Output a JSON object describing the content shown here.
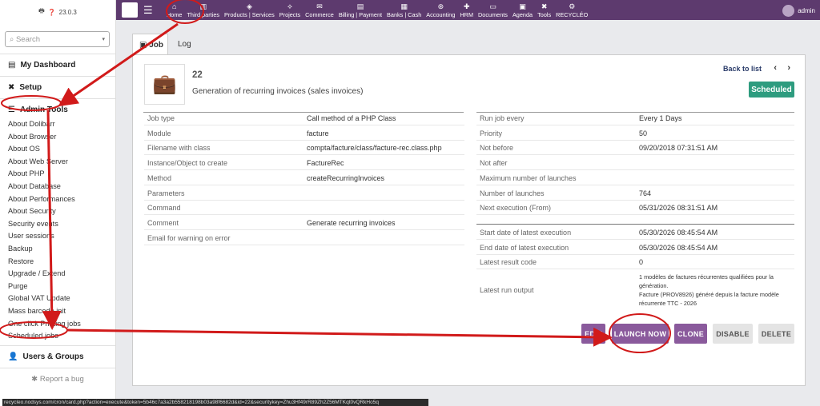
{
  "app": {
    "version": "23.0.3",
    "user": "admin"
  },
  "sidebar": {
    "search_placeholder": "Search",
    "dashboard": "My Dashboard",
    "setup": "Setup",
    "admin_tools": "Admin Tools",
    "items": [
      "About Dolibarr",
      "About Browser",
      "About OS",
      "About Web Server",
      "About PHP",
      "About Database",
      "About Performances",
      "About Security",
      "Security events",
      "User sessions",
      "Backup",
      "Restore",
      "Upgrade / Extend",
      "Purge",
      "Global VAT Update",
      "Mass barcode init",
      "One click Printing jobs",
      "Scheduled jobs"
    ],
    "users_groups": "Users & Groups",
    "report_bug": "Report a bug"
  },
  "topnav": [
    "Home",
    "Third parties",
    "Products | Services",
    "Projects",
    "Commerce",
    "Billing | Payment",
    "Banks | Cash",
    "Accounting",
    "HRM",
    "Documents",
    "Agenda",
    "Tools",
    "RECYCLÉO"
  ],
  "tabs": [
    "Job",
    "Log"
  ],
  "job": {
    "id": "22",
    "title": "Generation of recurring invoices (sales invoices)",
    "back": "Back to list",
    "status": "Scheduled",
    "left": [
      {
        "label": "Job type",
        "value": "Call method of a PHP Class"
      },
      {
        "label": "Module",
        "value": "facture"
      },
      {
        "label": "Filename with class",
        "value": "compta/facture/class/facture-rec.class.php"
      },
      {
        "label": "Instance/Object to create",
        "value": "FactureRec"
      },
      {
        "label": "Method",
        "value": "createRecurringInvoices"
      },
      {
        "label": "Parameters",
        "value": ""
      },
      {
        "label": "Command",
        "value": ""
      },
      {
        "label": "Comment",
        "value": "Generate recurring invoices"
      },
      {
        "label": "Email for warning on error",
        "value": ""
      }
    ],
    "right1": [
      {
        "label": "Run job every",
        "value": "Every 1 Days"
      },
      {
        "label": "Priority",
        "value": "50"
      },
      {
        "label": "Not before",
        "value": "09/20/2018 07:31:51 AM"
      },
      {
        "label": "Not after",
        "value": ""
      },
      {
        "label": "Maximum number of launches",
        "value": ""
      },
      {
        "label": "Number of launches",
        "value": "764"
      },
      {
        "label": "Next execution (From)",
        "value": "05/31/2026 08:31:51 AM"
      }
    ],
    "right2": [
      {
        "label": "Start date of latest execution",
        "value": "05/30/2026 08:45:54 AM"
      },
      {
        "label": "End date of latest execution",
        "value": "05/30/2026 08:45:54 AM"
      },
      {
        "label": "Latest result code",
        "value": "0"
      }
    ],
    "output_label": "Latest run output",
    "output": [
      "1 modèles de factures récurrentes qualifiées pour la",
      "génération.",
      "Facture (PROV8926) généré depuis la facture modèle",
      "récurrente TTC - 2026"
    ]
  },
  "buttons": [
    "EDIT",
    "LAUNCH NOW",
    "CLONE",
    "DISABLE",
    "DELETE"
  ],
  "statusbar": "recycleo.nodsys.com/cron/card.php?action=execute&token=5b46c7a3a2b558218198b03a98f6682d&id=22&securitykey=Zhu3Hf49rR89Zh2Z56MTKqt0vQRkHo5q",
  "colors": {
    "nav": "#5d3a6e",
    "button": "#8a5a9c",
    "status": "#2e9c7f",
    "annotation": "#d11a1a"
  }
}
